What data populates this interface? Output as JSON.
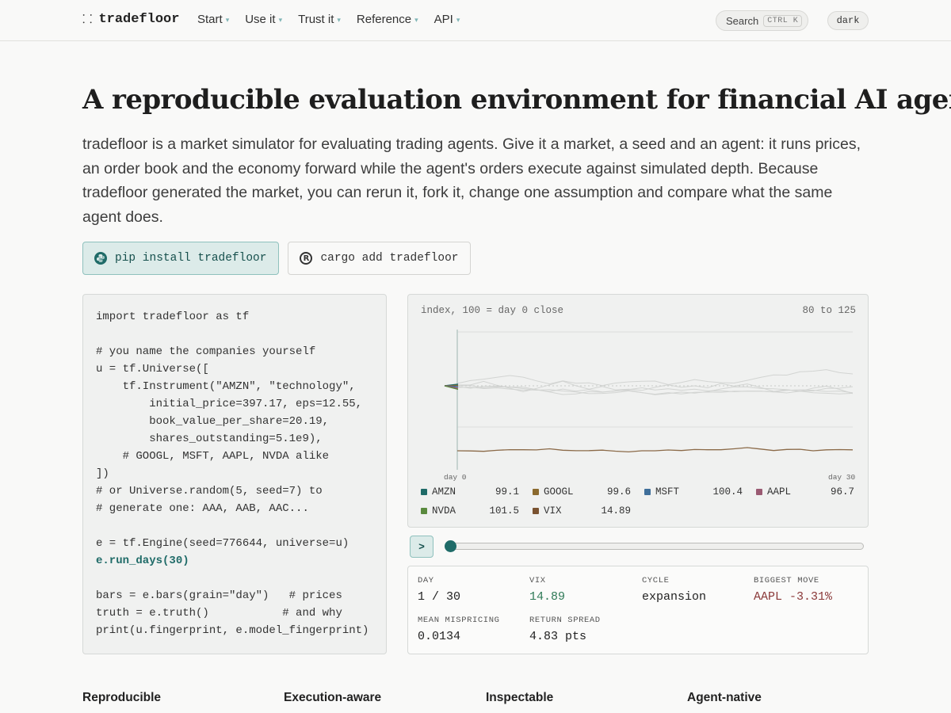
{
  "nav": {
    "logo_icon": "⸬",
    "logo_text": "tradefloor",
    "menu": [
      "Start",
      "Use it",
      "Trust it",
      "Reference",
      "API"
    ],
    "caret": "▾",
    "search_label": "Search",
    "search_kbd": "CTRL K",
    "theme_label": "dark"
  },
  "hero": {
    "title": "A reproducible evaluation environment for financial AI agents",
    "description": "tradefloor is a market simulator for evaluating trading agents. Give it a market, a seed and an agent: it runs prices, an order book and the economy forward while the agent's orders execute against simulated depth. Because tradefloor generated the market, you can rerun it, fork it, change one assumption and compare what the same agent does."
  },
  "install": {
    "pip": "pip install tradefloor",
    "cargo": "cargo add tradefloor",
    "pip_icon": "python-icon",
    "cargo_icon": "rust-icon"
  },
  "code": {
    "lines": [
      "import tradefloor as tf",
      "",
      "# you name the companies yourself",
      "u = tf.Universe([",
      "    tf.Instrument(\"AMZN\", \"technology\",",
      "        initial_price=397.17, eps=12.55,",
      "        book_value_per_share=20.19,",
      "        shares_outstanding=5.1e9),",
      "    # GOOGL, MSFT, AAPL, NVDA alike",
      "])",
      "# or Universe.random(5, seed=7) to",
      "# generate one: AAA, AAB, AAC...",
      "",
      "e = tf.Engine(seed=776644, universe=u)",
      "e.run_days(30)",
      "",
      "bars = e.bars(grain=\"day\")   # prices",
      "truth = e.truth()           # and why",
      "print(u.fingerprint, e.model_fingerprint)"
    ],
    "highlight_line": 14
  },
  "chart_data": {
    "type": "line",
    "caption": "index, 100 = day 0 close",
    "range_label": "80 to 125",
    "ylim": [
      80,
      125
    ],
    "x_start_label": "day 0",
    "x_end_label": "day 30",
    "current_day": 1,
    "legend": [
      {
        "name": "AMZN",
        "value": "99.1",
        "color": "#1f6b68"
      },
      {
        "name": "GOOGL",
        "value": "99.6",
        "color": "#8b6a2e"
      },
      {
        "name": "MSFT",
        "value": "100.4",
        "color": "#3f6f9a"
      },
      {
        "name": "AAPL",
        "value": "96.7",
        "color": "#9a5a72"
      },
      {
        "name": "NVDA",
        "value": "101.5",
        "color": "#5a8a3e"
      },
      {
        "name": "VIX",
        "value": "14.89",
        "color": "#7a5230"
      }
    ]
  },
  "slider": {
    "play_label": ">",
    "progress": 0.0
  },
  "stats": [
    {
      "label": "DAY",
      "value": "1 / 30",
      "tone": ""
    },
    {
      "label": "VIX",
      "value": "14.89",
      "tone": "teal"
    },
    {
      "label": "CYCLE",
      "value": "expansion",
      "tone": ""
    },
    {
      "label": "BIGGEST MOVE",
      "value": "AAPL -3.31%",
      "tone": "red"
    },
    {
      "label": "MEAN MISPRICING",
      "value": "0.0134",
      "tone": ""
    },
    {
      "label": "RETURN SPREAD",
      "value": "4.83 pts",
      "tone": ""
    }
  ],
  "features": [
    {
      "title": "Reproducible"
    },
    {
      "title": "Execution-aware"
    },
    {
      "title": "Inspectable"
    },
    {
      "title": "Agent-native"
    }
  ]
}
